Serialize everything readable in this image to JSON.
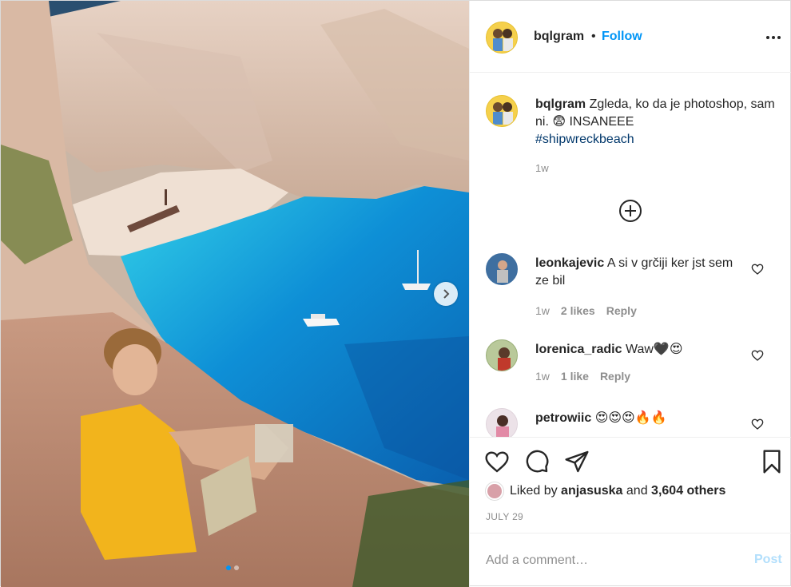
{
  "header": {
    "username": "bqlgram",
    "separator": "•",
    "follow_label": "Follow",
    "more_icon": "more-options-icon"
  },
  "caption": {
    "username": "bqlgram",
    "text": "Zgleda, ko da je photoshop, sam ni. 😨 INSANEEE",
    "hashtag": "#shipwreckbeach",
    "time": "1w"
  },
  "comments": [
    {
      "username": "leonkajevic",
      "text": "A si v grčiji ker jst sem ze bil",
      "time": "1w",
      "likes": "2 likes",
      "reply": "Reply"
    },
    {
      "username": "lorenica_radic",
      "text": "Waw🖤😍",
      "time": "1w",
      "likes": "1 like",
      "reply": "Reply"
    },
    {
      "username": "petrowiic",
      "text": "😍😍😍🔥🔥",
      "time": "",
      "likes": "",
      "reply": ""
    }
  ],
  "likes": {
    "prefix": "Liked by",
    "first_liker": "anjasuska",
    "middle": "and",
    "others": "3,604 others"
  },
  "date": "JULY 29",
  "add_comment": {
    "placeholder": "Add a comment…",
    "post_label": "Post"
  },
  "colors": {
    "accent": "#0095f6",
    "post_disabled": "#b2dffc",
    "muted": "#8e8e8e"
  }
}
